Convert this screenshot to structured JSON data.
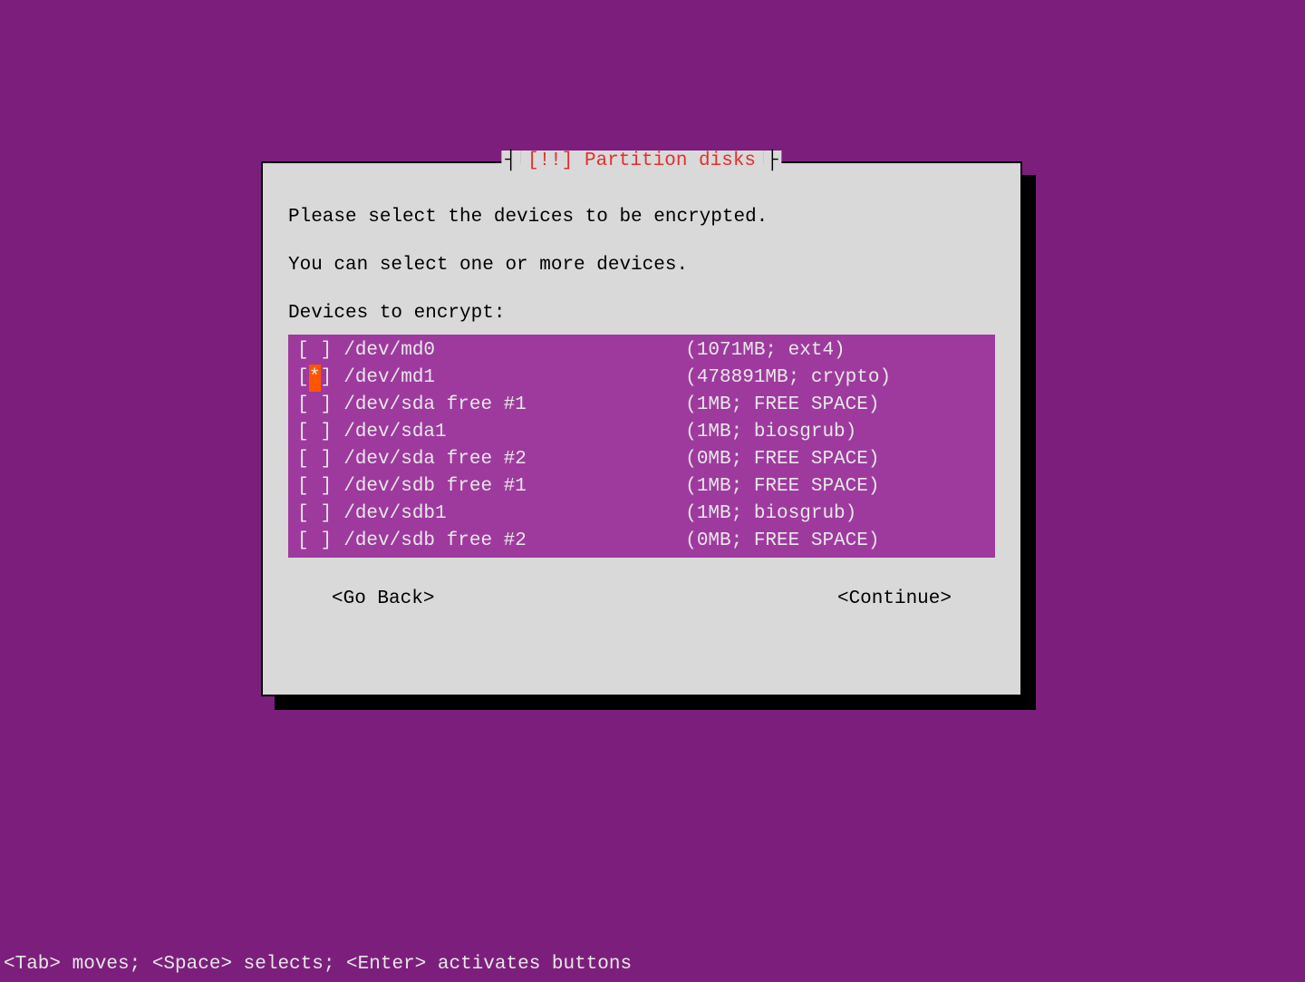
{
  "dialog": {
    "title_prefix": "[!!]",
    "title": "Partition disks",
    "instruction1": "Please select the devices to be encrypted.",
    "instruction2": "You can select one or more devices.",
    "list_label": "Devices to encrypt:",
    "go_back_label": "<Go Back>",
    "continue_label": "<Continue>"
  },
  "devices": [
    {
      "checked": false,
      "highlighted": false,
      "name": "/dev/md0",
      "info": "(1071MB; ext4)"
    },
    {
      "checked": true,
      "highlighted": true,
      "name": "/dev/md1",
      "info": "(478891MB; crypto)"
    },
    {
      "checked": false,
      "highlighted": false,
      "name": "/dev/sda free #1",
      "info": "(1MB; FREE SPACE)"
    },
    {
      "checked": false,
      "highlighted": false,
      "name": "/dev/sda1",
      "info": "(1MB; biosgrub)"
    },
    {
      "checked": false,
      "highlighted": false,
      "name": "/dev/sda free #2",
      "info": "(0MB; FREE SPACE)"
    },
    {
      "checked": false,
      "highlighted": false,
      "name": "/dev/sdb free #1",
      "info": "(1MB; FREE SPACE)"
    },
    {
      "checked": false,
      "highlighted": false,
      "name": "/dev/sdb1",
      "info": "(1MB; biosgrub)"
    },
    {
      "checked": false,
      "highlighted": false,
      "name": "/dev/sdb free #2",
      "info": "(0MB; FREE SPACE)"
    }
  ],
  "footer": {
    "help_text": "<Tab> moves; <Space> selects; <Enter> activates buttons"
  }
}
